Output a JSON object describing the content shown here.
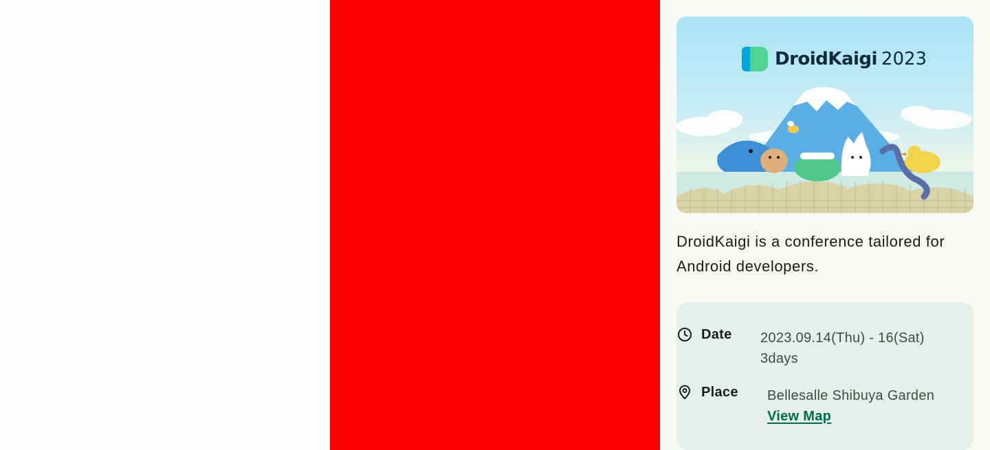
{
  "hero": {
    "brand": "DroidKaigi",
    "year": "2023",
    "logo_icon": "droidkaigi-logo-icon"
  },
  "description": "DroidKaigi is a conference tailored for Android developers.",
  "info": {
    "date": {
      "icon": "clock-icon",
      "label": "Date",
      "line1": "2023.09.14(Thu) - 16(Sat)",
      "line2": "3days"
    },
    "place": {
      "icon": "location-pin-icon",
      "label": "Place",
      "venue": "Bellesalle Shibuya Garden",
      "link": "View Map"
    }
  },
  "colors": {
    "middle_pane": "#ff0000",
    "right_pane_bg": "#f6f8f3",
    "card_bg": "#e6f0ea",
    "link": "#006d4a"
  }
}
